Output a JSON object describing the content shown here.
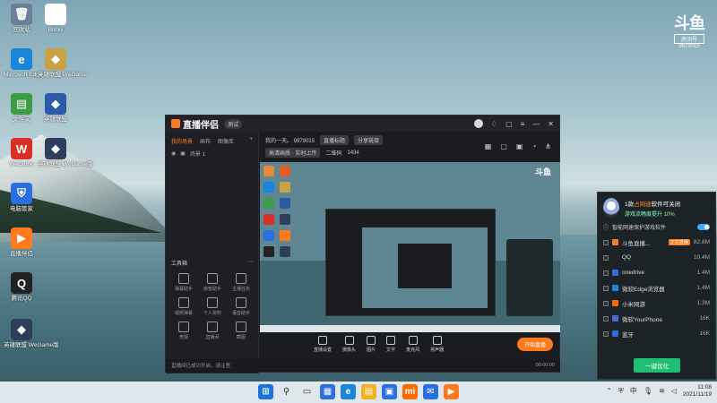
{
  "desktop": {
    "icons": [
      {
        "label": "回收站",
        "color": "#6b7f99",
        "glyph": "🗑"
      },
      {
        "label": "Bilibili",
        "color": "#ffffff",
        "glyph": "▶"
      },
      {
        "label": "Microsoft Edge",
        "color": "#1a86d9",
        "glyph": "e"
      },
      {
        "label": "英雄联盟 WeGame",
        "color": "#c9a245",
        "glyph": "◆"
      },
      {
        "label": "文件夹",
        "color": "#3e9c49",
        "glyph": "▤"
      },
      {
        "label": "英雄联盟",
        "color": "#2c5ba6",
        "glyph": "◆"
      },
      {
        "label": "WeGame",
        "color": "#d93025",
        "glyph": "W"
      },
      {
        "label": "英雄联盟 WeGame版",
        "color": "#2e3e5c",
        "glyph": "◆"
      },
      {
        "label": "电脑管家",
        "color": "#2a6fe0",
        "glyph": "⛨"
      },
      {
        "label": "直播伴侣",
        "color": "#ff7a1c",
        "glyph": "▶"
      },
      {
        "label": "腾讯QQ",
        "color": "#222222",
        "glyph": "Q"
      },
      {
        "label": "英雄联盟 WeGame版",
        "color": "#2e3e5c",
        "glyph": "◆"
      }
    ],
    "watermark": {
      "logo": "斗鱼",
      "room": "房间号",
      "room_id": "9979015"
    }
  },
  "app": {
    "name": "直播伴侣",
    "version": "测试",
    "tabs": [
      "我的场景",
      "画布",
      "图像库"
    ],
    "scene_label": "场景 1",
    "toolbox_label": "工具箱",
    "tools": [
      "弹幕助手",
      "房管助手",
      "主播任务",
      "视频弹幕",
      "个人资料",
      "语音助手",
      "竞猜",
      "直播间",
      "截图"
    ],
    "stream_title": "我的一天。 9979015",
    "stream_row2": [
      "直播标题",
      "分享链接"
    ],
    "stream_row3": [
      "高清画质 · 实时上传",
      "二维码",
      "1434"
    ],
    "bottom_tools": [
      "直播设置",
      "摄像头",
      "图片",
      "文字",
      "麦克风",
      "扬声器"
    ],
    "go_live": "开始直播",
    "notice": "直播间已成功开启，请注意",
    "status": "00:00:00"
  },
  "popup": {
    "title_prefix": "1款",
    "title_highlight": "占网速",
    "title_suffix": "软件可关闭",
    "subtitle_prefix": "游戏流畅度提升",
    "subtitle_pct": "10%",
    "accelerate_label": "智能网速保护游戏软件",
    "processes": [
      {
        "name": "斗鱼直播...",
        "tag": "正在直播",
        "size": "82.8M",
        "color": "#ff7a1c"
      },
      {
        "name": "QQ",
        "tag": "",
        "size": "10.4M",
        "color": "#222222"
      },
      {
        "name": "onedrive",
        "tag": "",
        "size": "1.4M",
        "color": "#2a6fe0"
      },
      {
        "name": "微软Edge浏览器",
        "tag": "",
        "size": "1.4M",
        "color": "#1a86d9"
      },
      {
        "name": "小米网游",
        "tag": "",
        "size": "1.3M",
        "color": "#ff6700"
      },
      {
        "name": "微软YourPhone",
        "tag": "",
        "size": "16K",
        "color": "#4a6bd6"
      },
      {
        "name": "蓝牙",
        "tag": "",
        "size": "16K",
        "color": "#2a6fe0"
      }
    ],
    "optimize_label": "一键优化"
  },
  "taskbar": {
    "apps": [
      {
        "name": "start",
        "glyph": "⊞",
        "color": "#1a73d9"
      },
      {
        "name": "search",
        "glyph": "⚲",
        "color": "#333333"
      },
      {
        "name": "task-view",
        "glyph": "▭",
        "color": "#333333"
      },
      {
        "name": "widgets",
        "glyph": "▦",
        "color": "#2a6fe0"
      },
      {
        "name": "edge",
        "glyph": "e",
        "color": "#1a86d9"
      },
      {
        "name": "explorer",
        "glyph": "▤",
        "color": "#f2b01e"
      },
      {
        "name": "store",
        "glyph": "▣",
        "color": "#2a6fe0"
      },
      {
        "name": "mi",
        "glyph": "mi",
        "color": "#ff6700"
      },
      {
        "name": "mail",
        "glyph": "✉",
        "color": "#2a6fe0"
      },
      {
        "name": "douyu",
        "glyph": "▶",
        "color": "#ff7a1c"
      }
    ],
    "time": "11:08",
    "date": "2021/11/19",
    "ime": "中"
  }
}
